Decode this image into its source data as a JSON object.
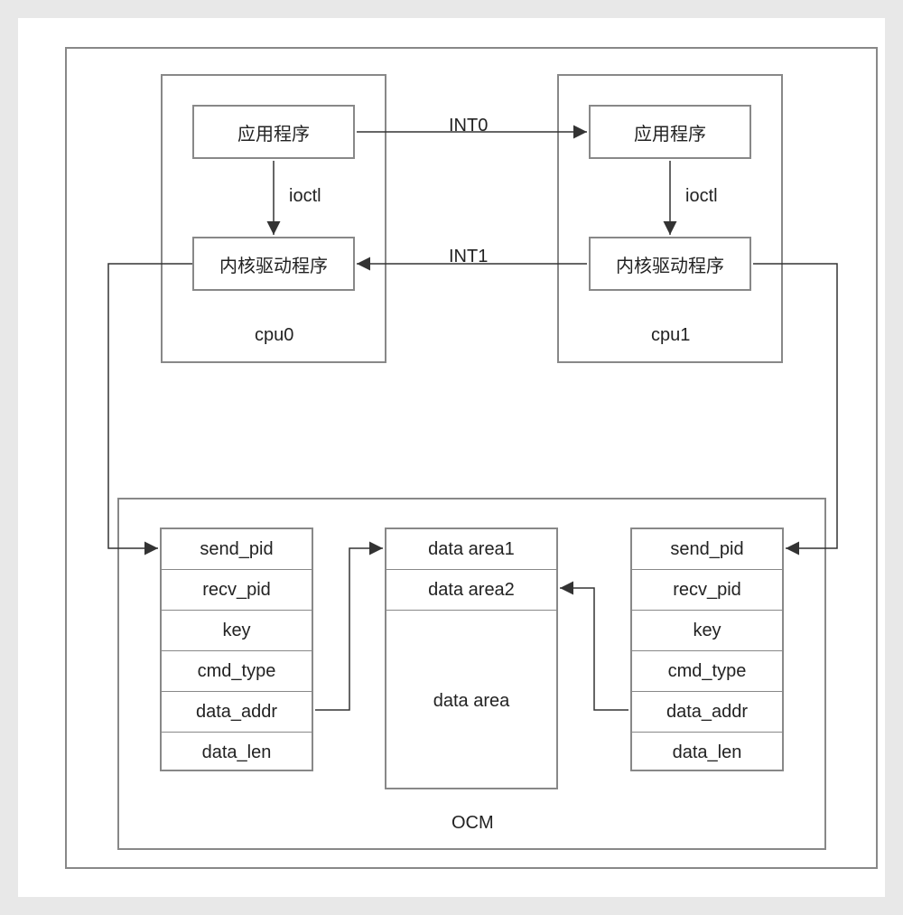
{
  "cpu0": {
    "app": "应用程序",
    "driver": "内核驱动程序",
    "ioctl": "ioctl",
    "label": "cpu0"
  },
  "cpu1": {
    "app": "应用程序",
    "driver": "内核驱动程序",
    "ioctl": "ioctl",
    "label": "cpu1"
  },
  "interrupts": {
    "int0": "INT0",
    "int1": "INT1"
  },
  "ocm": {
    "label": "OCM",
    "left_col": {
      "send_pid": "send_pid",
      "recv_pid": "recv_pid",
      "key": "key",
      "cmd_type": "cmd_type",
      "data_addr": "data_addr",
      "data_len": "data_len"
    },
    "right_col": {
      "send_pid": "send_pid",
      "recv_pid": "recv_pid",
      "key": "key",
      "cmd_type": "cmd_type",
      "data_addr": "data_addr",
      "data_len": "data_len"
    },
    "data_area": {
      "area1": "data area1",
      "area2": "data area2",
      "area": "data area"
    }
  }
}
